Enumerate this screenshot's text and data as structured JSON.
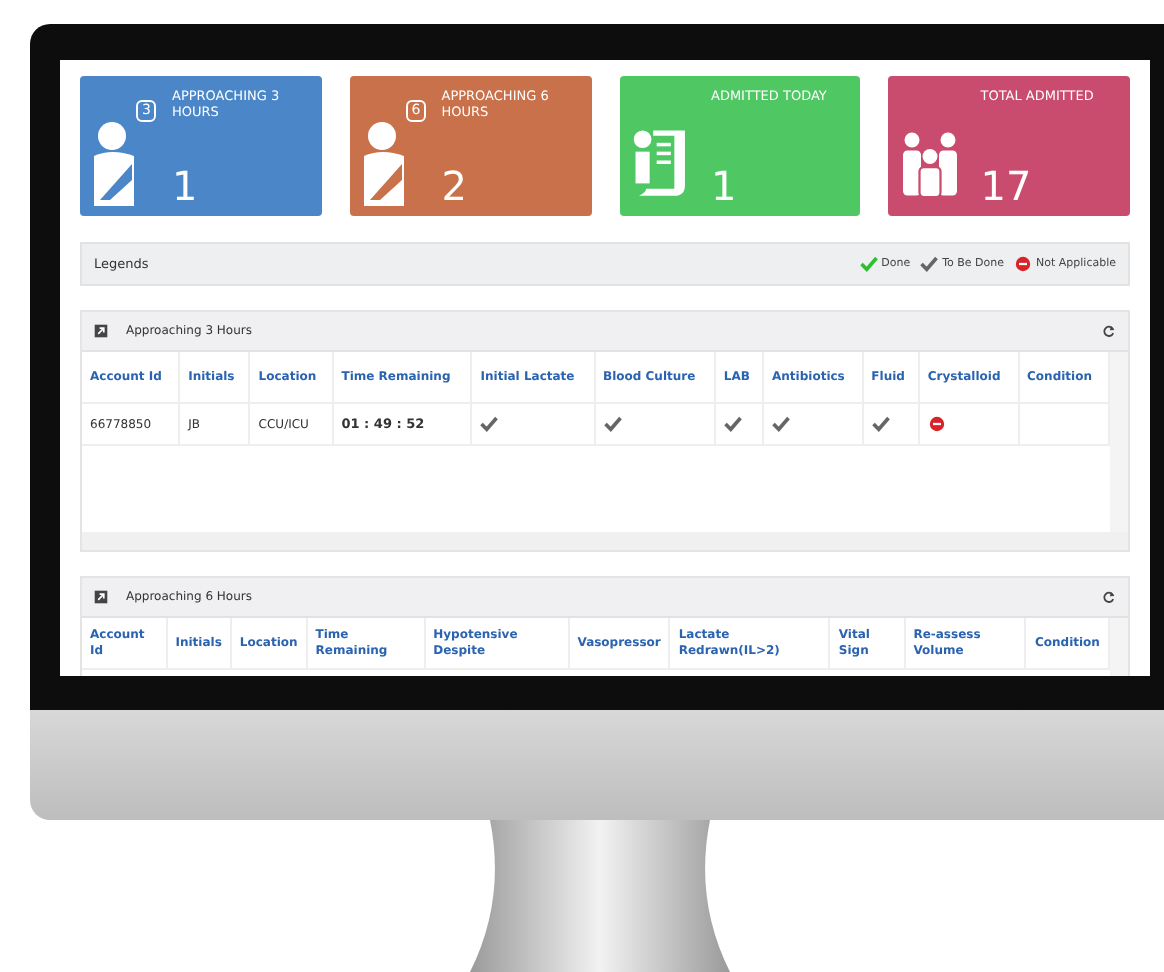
{
  "cards": [
    {
      "label": "APPROACHING 3 HOURS",
      "value": "1",
      "color": "#4a86c8",
      "kind": "patient",
      "badge": "3"
    },
    {
      "label": "APPROACHING 6 HOURS",
      "value": "2",
      "color": "#c8714a",
      "kind": "patient",
      "badge": "6"
    },
    {
      "label": "ADMITTED TODAY",
      "value": "1",
      "color": "#4fc863",
      "kind": "document"
    },
    {
      "label": "TOTAL ADMITTED",
      "value": "17",
      "color": "#c94c6e",
      "kind": "family"
    }
  ],
  "legends": {
    "title": "Legends",
    "items": [
      {
        "kind": "done",
        "label": "Done"
      },
      {
        "kind": "to_be_done",
        "label": "To Be Done"
      },
      {
        "kind": "not_applicable",
        "label": "Not Applicable"
      }
    ]
  },
  "panels": [
    {
      "title": "Approaching 3 Hours",
      "columns": [
        "Account Id",
        "Initials",
        "Location",
        "Time Remaining",
        "Initial Lactate",
        "Blood Culture",
        "LAB",
        "Antibiotics",
        "Fluid",
        "Crystalloid",
        "Condition"
      ],
      "rows": [
        {
          "account_id": "66778850",
          "initials": "JB",
          "location": "CCU/ICU",
          "time_remaining": "01 : 49 : 52",
          "checks": [
            {
              "kind": "to_be_done"
            },
            {
              "kind": "to_be_done"
            },
            {
              "kind": "to_be_done"
            },
            {
              "kind": "to_be_done"
            },
            {
              "kind": "to_be_done"
            },
            {
              "kind": "not_applicable"
            }
          ]
        }
      ]
    },
    {
      "title": "Approaching 6 Hours",
      "columns": [
        "Account Id",
        "Initials",
        "Location",
        "Time Remaining",
        "Hypotensive Despite",
        "Vasopressor",
        "Lactate Redrawn(IL>2)",
        "Vital Sign",
        "Re-assess Volume",
        "Condition"
      ]
    }
  ]
}
